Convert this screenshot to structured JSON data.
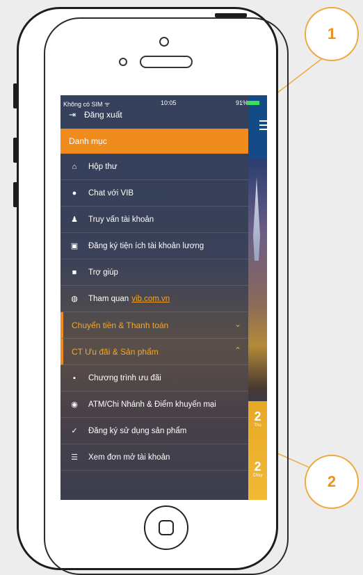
{
  "status_bar": {
    "carrier": "Không có SIM ᯤ",
    "time": "10:05",
    "battery": "91%"
  },
  "logout": {
    "label": "Đăng xuất",
    "icon": "logout-icon"
  },
  "section_main": "Danh mục",
  "menu_items": [
    {
      "label": "Hộp thư",
      "icon": "mailbox-icon"
    },
    {
      "label": "Chat với VIB",
      "icon": "chat-icon"
    },
    {
      "label": "Truy vấn tài khoản",
      "icon": "user-icon"
    },
    {
      "label": "Đăng ký tiện ích tài khoản lương",
      "icon": "id-card-icon"
    },
    {
      "label": "Trợ giúp",
      "icon": "help-icon"
    },
    {
      "label": "Tham quan",
      "link": "vib.com.vn",
      "icon": "globe-icon"
    }
  ],
  "section_transfer": "Chuyển tiền & Thanh toán",
  "section_promo": "CT Ưu đãi & Sản phẩm",
  "promo_items": [
    {
      "label": "Chương trình ưu đãi",
      "icon": "gift-icon"
    },
    {
      "label": "ATM/Chi Nhánh & Điểm khuyến mại",
      "icon": "location-icon"
    },
    {
      "label": "Đăng ký sử dụng sản phẩm",
      "icon": "check-icon"
    },
    {
      "label": "Xem đơn mở tài khoản",
      "icon": "list-icon"
    }
  ],
  "side_tiles": [
    "Thu",
    "Chuy"
  ],
  "callouts": [
    "1",
    "2"
  ],
  "colors": {
    "accent": "#f08c1e",
    "callout_border": "#f0a83a",
    "panel": "#3a4158"
  }
}
